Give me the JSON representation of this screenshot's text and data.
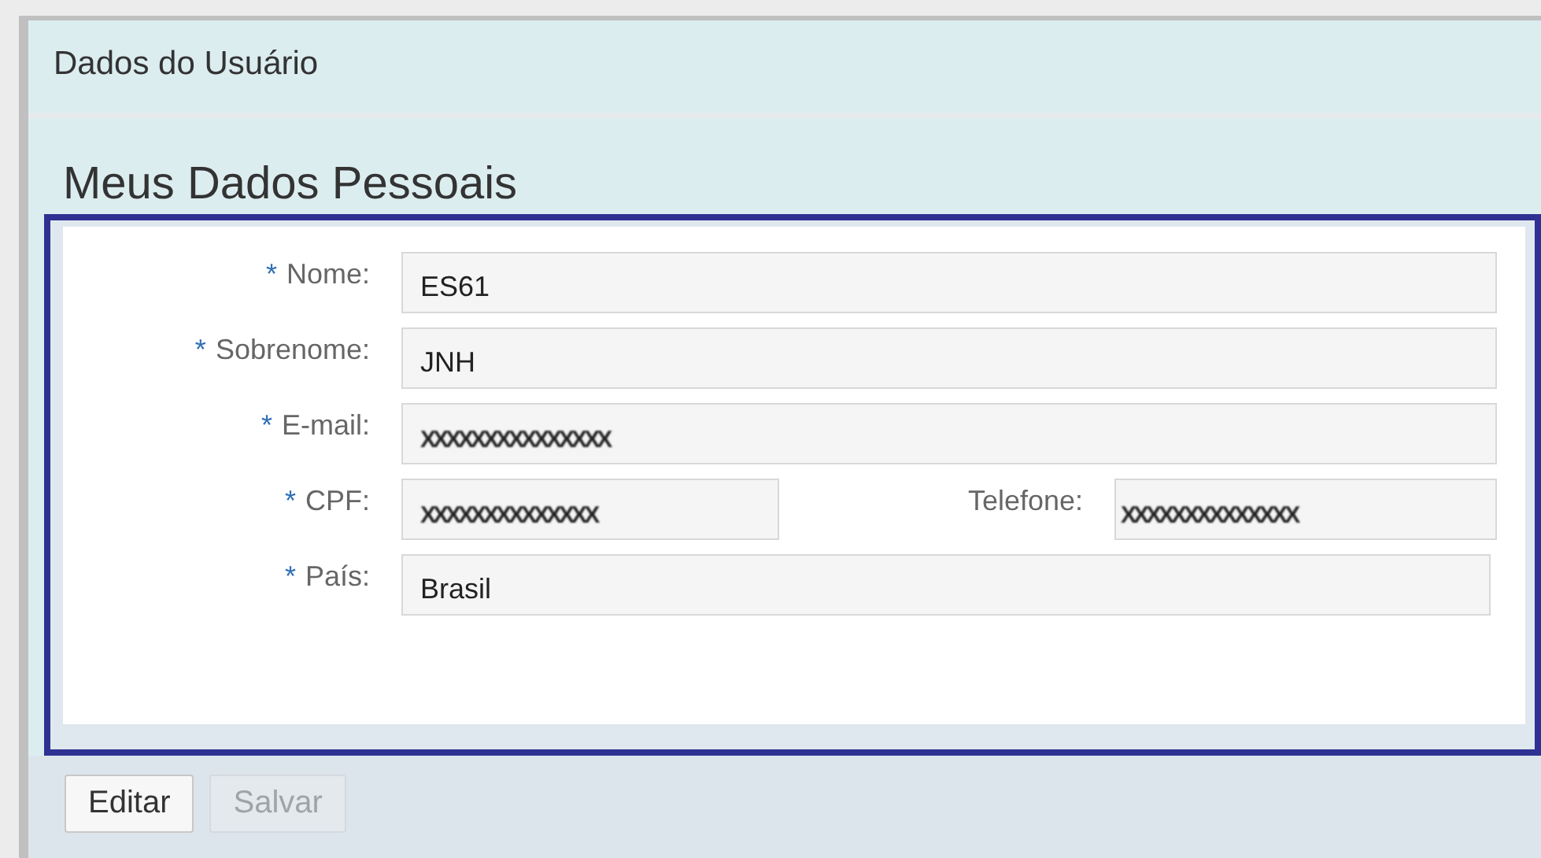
{
  "panel": {
    "title": "Dados do Usuário"
  },
  "section": {
    "title": "Meus Dados Pessoais"
  },
  "fields": [
    {
      "label": "Nome:",
      "required": true,
      "value": "ES61",
      "kind": "full"
    },
    {
      "label": "Sobrenome:",
      "required": true,
      "value": "JNH",
      "kind": "full"
    },
    {
      "label": "E-mail:",
      "required": true,
      "value": "XXXXXXXXXXXXXXX",
      "kind": "masked"
    },
    {
      "label": "CPF:",
      "required": true,
      "value": "XXXXXXXXXXXXXX",
      "kind": "pair",
      "extra": {
        "label": "Telefone:",
        "value": "XXXXXXXXXXXXXX"
      }
    },
    {
      "label": "País:",
      "required": true,
      "value": "Brasil",
      "kind": "full"
    }
  ],
  "required_mark": "*",
  "buttons": [
    {
      "label": "Editar",
      "disabled": false
    },
    {
      "label": "Salvar",
      "disabled": true
    }
  ]
}
